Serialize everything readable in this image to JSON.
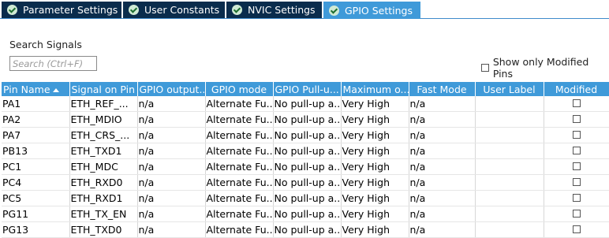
{
  "tabs": [
    {
      "label": "Parameter Settings",
      "active": false
    },
    {
      "label": "User Constants",
      "active": false
    },
    {
      "label": "NVIC Settings",
      "active": false
    },
    {
      "label": "GPIO Settings",
      "active": true
    }
  ],
  "search": {
    "label": "Search Signals",
    "placeholder": "Search (Ctrl+F)",
    "value": ""
  },
  "show_modified": {
    "label": "Show only Modified Pins",
    "checked": false
  },
  "table": {
    "columns": [
      "Pin Name",
      "Signal on Pin",
      "GPIO output...",
      "GPIO mode",
      "GPIO Pull-u...",
      "Maximum o...",
      "Fast Mode",
      "User Label",
      "Modified"
    ],
    "rows": [
      {
        "pin": "PA1",
        "signal": "ETH_REF_...",
        "output": "n/a",
        "mode": "Alternate Fu...",
        "pull": "No pull-up a...",
        "max": "Very High",
        "fast": "n/a",
        "label": "",
        "modified": false
      },
      {
        "pin": "PA2",
        "signal": "ETH_MDIO",
        "output": "n/a",
        "mode": "Alternate Fu...",
        "pull": "No pull-up a...",
        "max": "Very High",
        "fast": "n/a",
        "label": "",
        "modified": false
      },
      {
        "pin": "PA7",
        "signal": "ETH_CRS_...",
        "output": "n/a",
        "mode": "Alternate Fu...",
        "pull": "No pull-up a...",
        "max": "Very High",
        "fast": "n/a",
        "label": "",
        "modified": false
      },
      {
        "pin": "PB13",
        "signal": "ETH_TXD1",
        "output": "n/a",
        "mode": "Alternate Fu...",
        "pull": "No pull-up a...",
        "max": "Very High",
        "fast": "n/a",
        "label": "",
        "modified": false
      },
      {
        "pin": "PC1",
        "signal": "ETH_MDC",
        "output": "n/a",
        "mode": "Alternate Fu...",
        "pull": "No pull-up a...",
        "max": "Very High",
        "fast": "n/a",
        "label": "",
        "modified": false
      },
      {
        "pin": "PC4",
        "signal": "ETH_RXD0",
        "output": "n/a",
        "mode": "Alternate Fu...",
        "pull": "No pull-up a...",
        "max": "Very High",
        "fast": "n/a",
        "label": "",
        "modified": false
      },
      {
        "pin": "PC5",
        "signal": "ETH_RXD1",
        "output": "n/a",
        "mode": "Alternate Fu...",
        "pull": "No pull-up a...",
        "max": "Very High",
        "fast": "n/a",
        "label": "",
        "modified": false
      },
      {
        "pin": "PG11",
        "signal": "ETH_TX_EN",
        "output": "n/a",
        "mode": "Alternate Fu...",
        "pull": "No pull-up a...",
        "max": "Very High",
        "fast": "n/a",
        "label": "",
        "modified": false
      },
      {
        "pin": "PG13",
        "signal": "ETH_TXD0",
        "output": "n/a",
        "mode": "Alternate Fu...",
        "pull": "No pull-up a...",
        "max": "Very High",
        "fast": "n/a",
        "label": "",
        "modified": false
      }
    ]
  }
}
